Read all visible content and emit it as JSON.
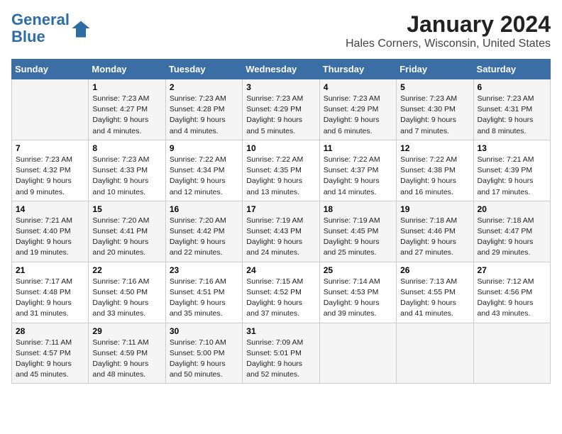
{
  "logo": {
    "line1": "General",
    "line2": "Blue"
  },
  "title": "January 2024",
  "subtitle": "Hales Corners, Wisconsin, United States",
  "days_of_week": [
    "Sunday",
    "Monday",
    "Tuesday",
    "Wednesday",
    "Thursday",
    "Friday",
    "Saturday"
  ],
  "weeks": [
    [
      {
        "day": "",
        "sunrise": "",
        "sunset": "",
        "daylight": ""
      },
      {
        "day": "1",
        "sunrise": "Sunrise: 7:23 AM",
        "sunset": "Sunset: 4:27 PM",
        "daylight": "Daylight: 9 hours and 4 minutes."
      },
      {
        "day": "2",
        "sunrise": "Sunrise: 7:23 AM",
        "sunset": "Sunset: 4:28 PM",
        "daylight": "Daylight: 9 hours and 4 minutes."
      },
      {
        "day": "3",
        "sunrise": "Sunrise: 7:23 AM",
        "sunset": "Sunset: 4:29 PM",
        "daylight": "Daylight: 9 hours and 5 minutes."
      },
      {
        "day": "4",
        "sunrise": "Sunrise: 7:23 AM",
        "sunset": "Sunset: 4:29 PM",
        "daylight": "Daylight: 9 hours and 6 minutes."
      },
      {
        "day": "5",
        "sunrise": "Sunrise: 7:23 AM",
        "sunset": "Sunset: 4:30 PM",
        "daylight": "Daylight: 9 hours and 7 minutes."
      },
      {
        "day": "6",
        "sunrise": "Sunrise: 7:23 AM",
        "sunset": "Sunset: 4:31 PM",
        "daylight": "Daylight: 9 hours and 8 minutes."
      }
    ],
    [
      {
        "day": "7",
        "sunrise": "Sunrise: 7:23 AM",
        "sunset": "Sunset: 4:32 PM",
        "daylight": "Daylight: 9 hours and 9 minutes."
      },
      {
        "day": "8",
        "sunrise": "Sunrise: 7:23 AM",
        "sunset": "Sunset: 4:33 PM",
        "daylight": "Daylight: 9 hours and 10 minutes."
      },
      {
        "day": "9",
        "sunrise": "Sunrise: 7:22 AM",
        "sunset": "Sunset: 4:34 PM",
        "daylight": "Daylight: 9 hours and 12 minutes."
      },
      {
        "day": "10",
        "sunrise": "Sunrise: 7:22 AM",
        "sunset": "Sunset: 4:35 PM",
        "daylight": "Daylight: 9 hours and 13 minutes."
      },
      {
        "day": "11",
        "sunrise": "Sunrise: 7:22 AM",
        "sunset": "Sunset: 4:37 PM",
        "daylight": "Daylight: 9 hours and 14 minutes."
      },
      {
        "day": "12",
        "sunrise": "Sunrise: 7:22 AM",
        "sunset": "Sunset: 4:38 PM",
        "daylight": "Daylight: 9 hours and 16 minutes."
      },
      {
        "day": "13",
        "sunrise": "Sunrise: 7:21 AM",
        "sunset": "Sunset: 4:39 PM",
        "daylight": "Daylight: 9 hours and 17 minutes."
      }
    ],
    [
      {
        "day": "14",
        "sunrise": "Sunrise: 7:21 AM",
        "sunset": "Sunset: 4:40 PM",
        "daylight": "Daylight: 9 hours and 19 minutes."
      },
      {
        "day": "15",
        "sunrise": "Sunrise: 7:20 AM",
        "sunset": "Sunset: 4:41 PM",
        "daylight": "Daylight: 9 hours and 20 minutes."
      },
      {
        "day": "16",
        "sunrise": "Sunrise: 7:20 AM",
        "sunset": "Sunset: 4:42 PM",
        "daylight": "Daylight: 9 hours and 22 minutes."
      },
      {
        "day": "17",
        "sunrise": "Sunrise: 7:19 AM",
        "sunset": "Sunset: 4:43 PM",
        "daylight": "Daylight: 9 hours and 24 minutes."
      },
      {
        "day": "18",
        "sunrise": "Sunrise: 7:19 AM",
        "sunset": "Sunset: 4:45 PM",
        "daylight": "Daylight: 9 hours and 25 minutes."
      },
      {
        "day": "19",
        "sunrise": "Sunrise: 7:18 AM",
        "sunset": "Sunset: 4:46 PM",
        "daylight": "Daylight: 9 hours and 27 minutes."
      },
      {
        "day": "20",
        "sunrise": "Sunrise: 7:18 AM",
        "sunset": "Sunset: 4:47 PM",
        "daylight": "Daylight: 9 hours and 29 minutes."
      }
    ],
    [
      {
        "day": "21",
        "sunrise": "Sunrise: 7:17 AM",
        "sunset": "Sunset: 4:48 PM",
        "daylight": "Daylight: 9 hours and 31 minutes."
      },
      {
        "day": "22",
        "sunrise": "Sunrise: 7:16 AM",
        "sunset": "Sunset: 4:50 PM",
        "daylight": "Daylight: 9 hours and 33 minutes."
      },
      {
        "day": "23",
        "sunrise": "Sunrise: 7:16 AM",
        "sunset": "Sunset: 4:51 PM",
        "daylight": "Daylight: 9 hours and 35 minutes."
      },
      {
        "day": "24",
        "sunrise": "Sunrise: 7:15 AM",
        "sunset": "Sunset: 4:52 PM",
        "daylight": "Daylight: 9 hours and 37 minutes."
      },
      {
        "day": "25",
        "sunrise": "Sunrise: 7:14 AM",
        "sunset": "Sunset: 4:53 PM",
        "daylight": "Daylight: 9 hours and 39 minutes."
      },
      {
        "day": "26",
        "sunrise": "Sunrise: 7:13 AM",
        "sunset": "Sunset: 4:55 PM",
        "daylight": "Daylight: 9 hours and 41 minutes."
      },
      {
        "day": "27",
        "sunrise": "Sunrise: 7:12 AM",
        "sunset": "Sunset: 4:56 PM",
        "daylight": "Daylight: 9 hours and 43 minutes."
      }
    ],
    [
      {
        "day": "28",
        "sunrise": "Sunrise: 7:11 AM",
        "sunset": "Sunset: 4:57 PM",
        "daylight": "Daylight: 9 hours and 45 minutes."
      },
      {
        "day": "29",
        "sunrise": "Sunrise: 7:11 AM",
        "sunset": "Sunset: 4:59 PM",
        "daylight": "Daylight: 9 hours and 48 minutes."
      },
      {
        "day": "30",
        "sunrise": "Sunrise: 7:10 AM",
        "sunset": "Sunset: 5:00 PM",
        "daylight": "Daylight: 9 hours and 50 minutes."
      },
      {
        "day": "31",
        "sunrise": "Sunrise: 7:09 AM",
        "sunset": "Sunset: 5:01 PM",
        "daylight": "Daylight: 9 hours and 52 minutes."
      },
      {
        "day": "",
        "sunrise": "",
        "sunset": "",
        "daylight": ""
      },
      {
        "day": "",
        "sunrise": "",
        "sunset": "",
        "daylight": ""
      },
      {
        "day": "",
        "sunrise": "",
        "sunset": "",
        "daylight": ""
      }
    ]
  ]
}
